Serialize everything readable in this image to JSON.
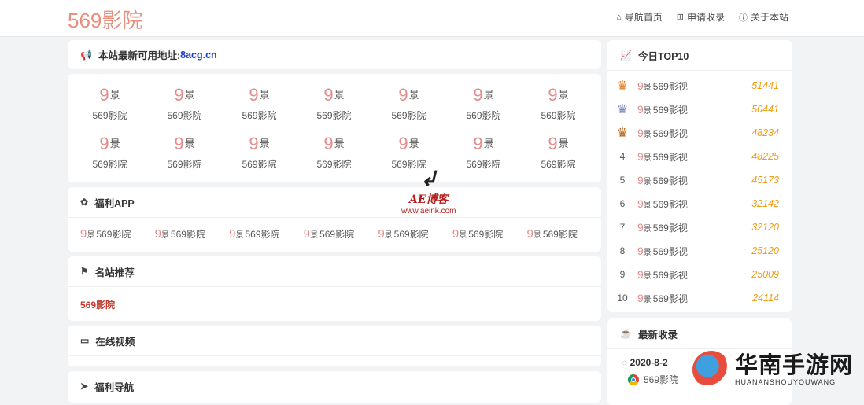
{
  "header": {
    "logo": "569影院",
    "nav": [
      {
        "icon": "home-icon",
        "label": "导航首页"
      },
      {
        "icon": "plus-square-icon",
        "label": "申请收录"
      },
      {
        "icon": "info-circle-icon",
        "label": "关于本站"
      }
    ]
  },
  "notice": {
    "prefix": "本站最新可用地址:",
    "address": "8acg.cn"
  },
  "sites": {
    "logo_num": "9",
    "logo_char": "景",
    "items": [
      "569影院",
      "569影院",
      "569影院",
      "569影院",
      "569影院",
      "569影院",
      "569影院",
      "569影院",
      "569影院",
      "569影院",
      "569影院",
      "569影院",
      "569影院",
      "569影院"
    ]
  },
  "apps": {
    "title": "福利APP",
    "items": [
      "569影院",
      "569影院",
      "569影院",
      "569影院",
      "569影院",
      "569影院",
      "569影院"
    ]
  },
  "famous": {
    "title": "名站推荐",
    "item": "569影院"
  },
  "video": {
    "title": "在线视频"
  },
  "welfare_nav": {
    "title": "福利导航"
  },
  "top10": {
    "title": "今日TOP10",
    "items": [
      {
        "rank": "",
        "name": "569影视",
        "score": "51441"
      },
      {
        "rank": "",
        "name": "569影视",
        "score": "50441"
      },
      {
        "rank": "",
        "name": "569影视",
        "score": "48234"
      },
      {
        "rank": "4",
        "name": "569影视",
        "score": "48225"
      },
      {
        "rank": "5",
        "name": "569影视",
        "score": "45173"
      },
      {
        "rank": "6",
        "name": "569影视",
        "score": "32142"
      },
      {
        "rank": "7",
        "name": "569影视",
        "score": "32120"
      },
      {
        "rank": "8",
        "name": "569影视",
        "score": "25120"
      },
      {
        "rank": "9",
        "name": "569影视",
        "score": "25009"
      },
      {
        "rank": "10",
        "name": "569影视",
        "score": "24114"
      }
    ],
    "crown_colors": [
      "#e67e22",
      "#6b7fb3",
      "#b5651d"
    ]
  },
  "latest": {
    "title": "最新收录",
    "date": "2020-8-2",
    "site": "569影院"
  },
  "watermarks": {
    "blog_name": "AE博客",
    "blog_url": "www.aeink.com",
    "brand": "华南手游网",
    "brand_sub": "HUANANSHOUYOUWANG"
  },
  "colors": {
    "accent": "#e7907d",
    "score": "#f39c12",
    "link_red": "#c0392b"
  }
}
